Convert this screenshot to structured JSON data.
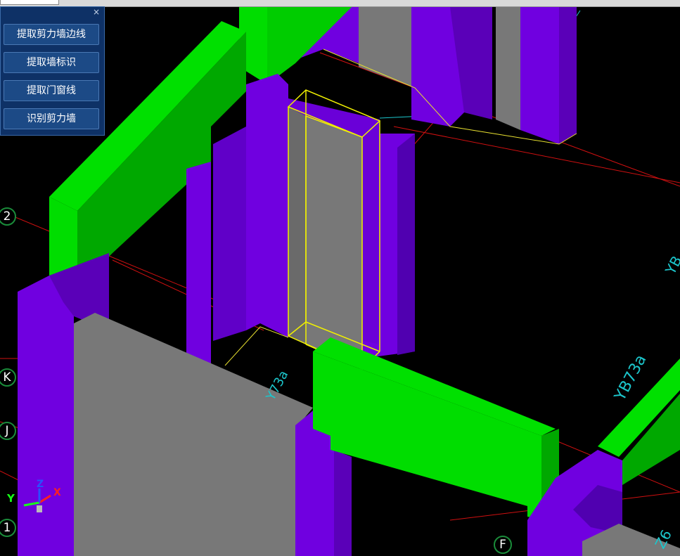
{
  "panel": {
    "close_glyph": "×",
    "buttons": [
      {
        "label": "提取剪力墙边线"
      },
      {
        "label": "提取墙标识"
      },
      {
        "label": "提取门窗线"
      },
      {
        "label": "识别剪力墙"
      }
    ]
  },
  "axis_markers": {
    "axis_2": "2",
    "axis_k": "K",
    "axis_j": "J",
    "axis_1": "1",
    "axis_f": "F"
  },
  "annotations": {
    "wall_label_a": "Y73a",
    "wall_label_b": "YB73a",
    "wall_label_c": "YB",
    "wall_label_d": "Z6"
  },
  "gizmo": {
    "y": "Y",
    "z": "Z",
    "x": "X"
  },
  "colors": {
    "background": "#000000",
    "wall_purple": "#7000e0",
    "beam_green": "#00dd00",
    "wall_gray": "#787878",
    "selection": "#f0f000",
    "grid_line": "#d01010",
    "dimension": "#1cc6cc",
    "panel_bg": "#0e3166"
  }
}
